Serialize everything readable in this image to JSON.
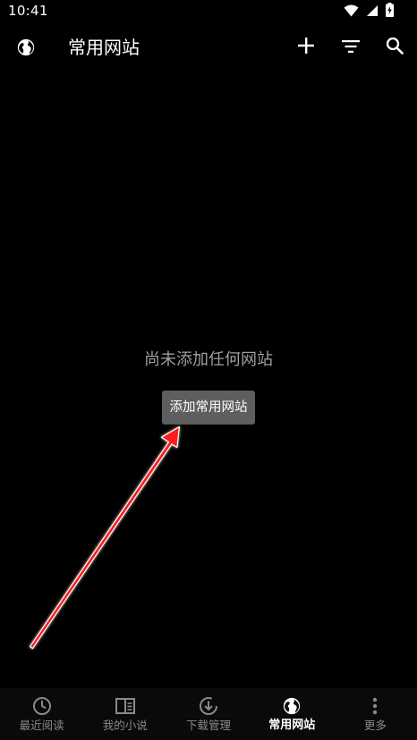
{
  "status_bar": {
    "time": "10:41"
  },
  "app_bar": {
    "title": "常用网站",
    "icons": [
      "globe-icon",
      "add-icon",
      "filter-icon",
      "search-icon"
    ]
  },
  "empty_state": {
    "message": "尚未添加任何网站",
    "button_label": "添加常用网站"
  },
  "bottom_nav": {
    "items": [
      {
        "label": "最近阅读",
        "icon": "clock-icon",
        "active": false
      },
      {
        "label": "我的小说",
        "icon": "book-icon",
        "active": false
      },
      {
        "label": "下载管理",
        "icon": "download-icon",
        "active": false
      },
      {
        "label": "常用网站",
        "icon": "globe-icon",
        "active": true
      },
      {
        "label": "更多",
        "icon": "more-icon",
        "active": false
      }
    ]
  },
  "colors": {
    "background": "#000000",
    "button_bg": "#5e5e5e",
    "empty_text": "#9e9e9e",
    "arrow": "#ff1a1a",
    "nav_inactive": "#8a8a8a",
    "nav_active": "#ffffff"
  }
}
